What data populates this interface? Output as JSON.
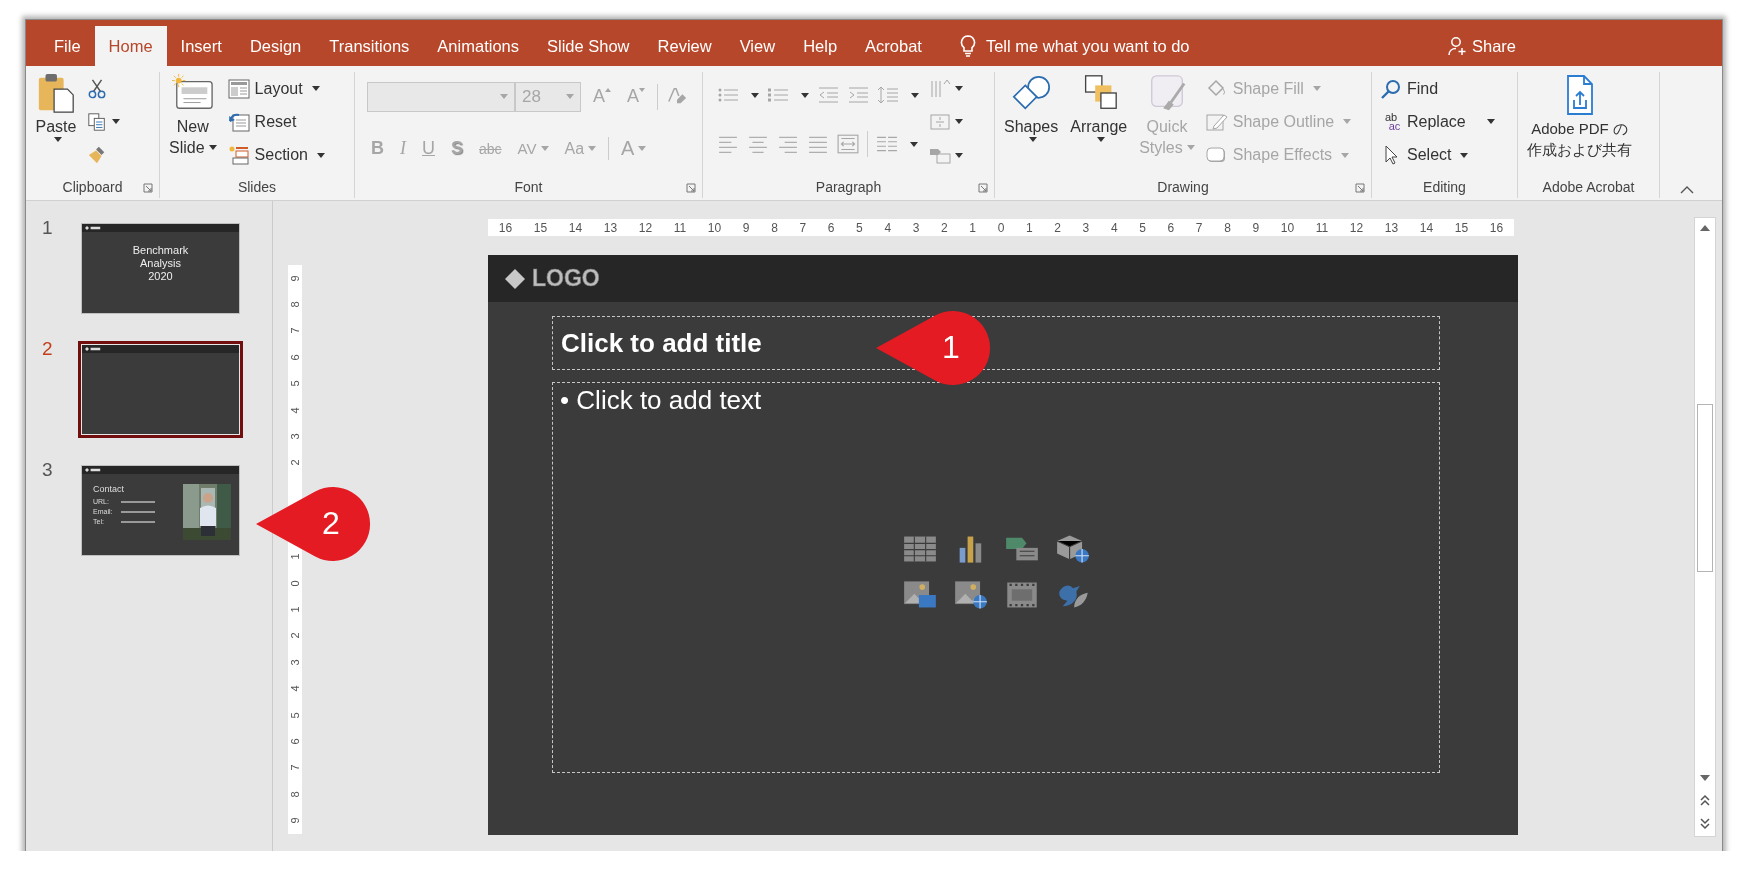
{
  "tabs": [
    {
      "label": "File",
      "selected": false
    },
    {
      "label": "Home",
      "selected": true
    },
    {
      "label": "Insert",
      "selected": false
    },
    {
      "label": "Design",
      "selected": false
    },
    {
      "label": "Transitions",
      "selected": false
    },
    {
      "label": "Animations",
      "selected": false
    },
    {
      "label": "Slide Show",
      "selected": false
    },
    {
      "label": "Review",
      "selected": false
    },
    {
      "label": "View",
      "selected": false
    },
    {
      "label": "Help",
      "selected": false
    },
    {
      "label": "Acrobat",
      "selected": false
    }
  ],
  "tell_me": "Tell me what you want to do",
  "share": "Share",
  "clipboard": {
    "label": "Clipboard",
    "paste": "Paste"
  },
  "slides_group": {
    "label": "Slides",
    "new_slide": [
      "New",
      "Slide"
    ],
    "items": [
      {
        "label": "Layout",
        "kind": "layout"
      },
      {
        "label": "Reset",
        "kind": "reset"
      },
      {
        "label": "Section",
        "kind": "section"
      }
    ]
  },
  "font": {
    "label": "Font",
    "disabled": true,
    "size": "28",
    "size_buttons": [
      {
        "label": "A",
        "kind": "grow"
      },
      {
        "label": "A",
        "kind": "shrink"
      }
    ],
    "format_buttons": [
      {
        "label": "B",
        "kind": "bold"
      },
      {
        "label": "I",
        "kind": "italic"
      },
      {
        "label": "U",
        "kind": "underline"
      },
      {
        "label": "S",
        "kind": "shadow"
      },
      {
        "label": "abc",
        "kind": "strike"
      },
      {
        "label": "AV",
        "kind": "spacing"
      },
      {
        "label": "Aa",
        "kind": "case"
      },
      {
        "label": "A",
        "kind": "color"
      }
    ]
  },
  "paragraph": {
    "label": "Paragraph",
    "disabled": true
  },
  "drawing": {
    "label": "Drawing",
    "shapes": "Shapes",
    "arrange": "Arrange",
    "quick_styles": {
      "lines": [
        "Quick",
        "Styles"
      ],
      "disabled": true
    },
    "items": [
      {
        "label": "Shape Fill",
        "kind": "fill",
        "disabled": true
      },
      {
        "label": "Shape Outline",
        "kind": "outline",
        "disabled": true
      },
      {
        "label": "Shape Effects",
        "kind": "effects",
        "disabled": true
      }
    ]
  },
  "editing": {
    "label": "Editing",
    "replace_icon": [
      "ab",
      "ac"
    ],
    "items": [
      {
        "label": "Find",
        "kind": "find"
      },
      {
        "label": "Replace",
        "kind": "replace"
      },
      {
        "label": "Select",
        "kind": "select"
      }
    ]
  },
  "acrobat": {
    "label": "Adobe Acrobat",
    "button": [
      "Adobe PDF の",
      "作成および共有"
    ]
  },
  "thumbnails": [
    {
      "number": "1",
      "selected": false,
      "kind": "title",
      "lines": [
        "Benchmark",
        "Analysis",
        "2020"
      ]
    },
    {
      "number": "2",
      "selected": true,
      "kind": "blank"
    },
    {
      "number": "3",
      "selected": false,
      "kind": "contact",
      "title": "Contact",
      "labels": [
        "URL:",
        "Email:",
        "Tel:"
      ]
    }
  ],
  "horizontal_ruler": [
    "16",
    "15",
    "14",
    "13",
    "12",
    "11",
    "10",
    "9",
    "8",
    "7",
    "6",
    "5",
    "4",
    "3",
    "2",
    "1",
    "0",
    "1",
    "2",
    "3",
    "4",
    "5",
    "6",
    "7",
    "8",
    "9",
    "10",
    "11",
    "12",
    "13",
    "14",
    "15",
    "16"
  ],
  "vertical_ruler": [
    "9",
    "8",
    "7",
    "6",
    "5",
    "4",
    "3",
    "2",
    "1",
    "0",
    "1",
    "2",
    "3",
    "4",
    "5",
    "6",
    "7",
    "8",
    "9"
  ],
  "slide": {
    "logo": "LOGO",
    "title_placeholder": "Click to add title",
    "body_placeholder": "• Click to add text"
  },
  "callouts": [
    {
      "number": "1"
    },
    {
      "number": "2"
    }
  ]
}
